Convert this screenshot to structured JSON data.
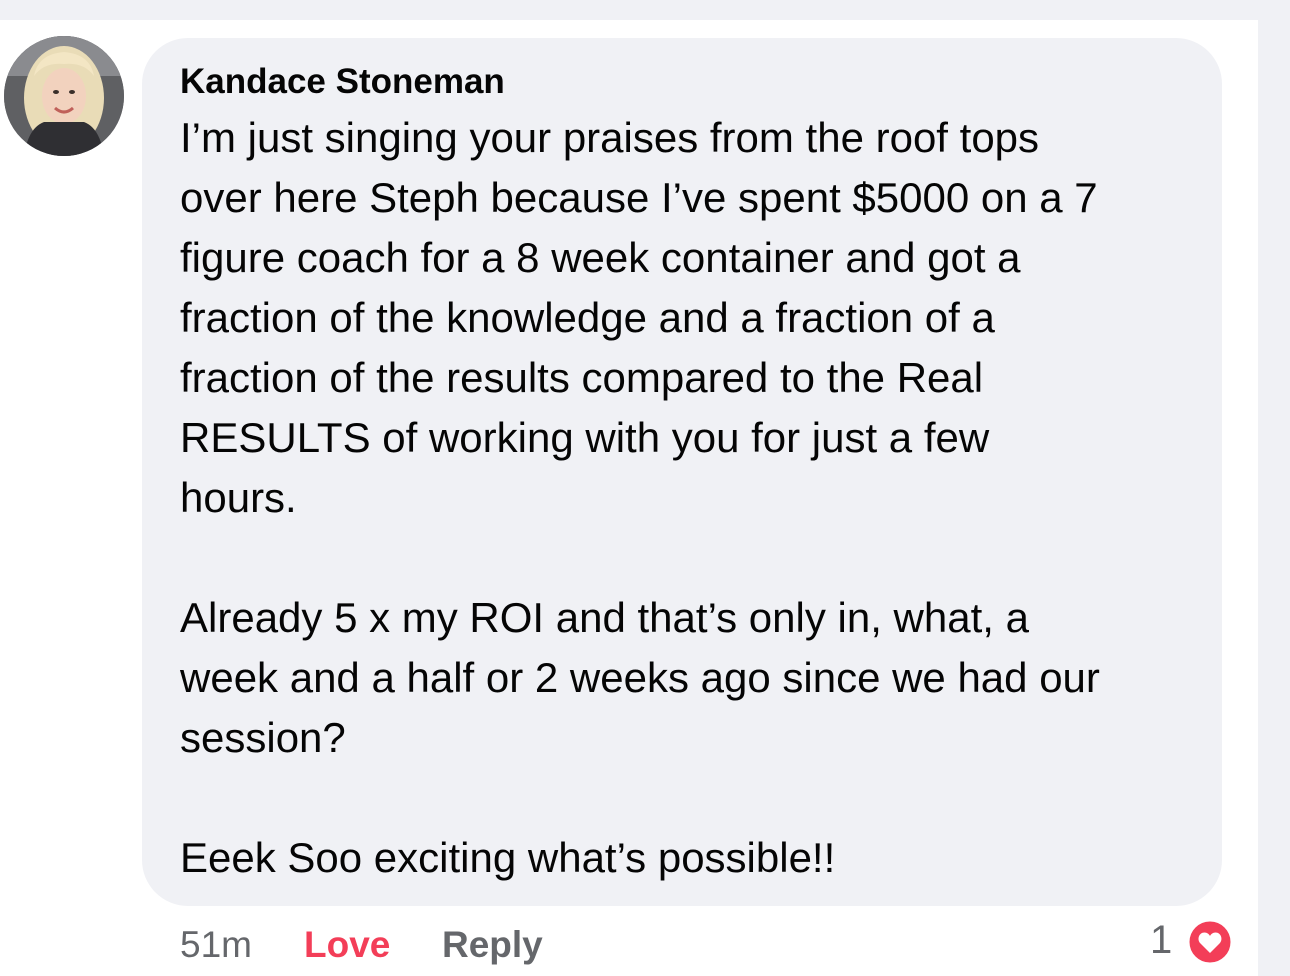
{
  "comment": {
    "author": "Kandace Stoneman",
    "paragraphs": [
      {
        "lines": [
          "I’m just singing your praises from the roof tops",
          "over here Steph because I’ve spent $5000 on a 7",
          "figure coach for a 8 week container and got a",
          "fraction of the knowledge and a fraction of a",
          "fraction of the results compared to the Real",
          "RESULTS of working with you for just a few",
          "hours."
        ]
      },
      {
        "lines": [
          "Already 5 x my ROI and that’s only in, what, a",
          "week and a half or 2 weeks ago since we had our",
          "session?"
        ]
      },
      {
        "lines": [
          "Eeek Soo exciting what’s possible!!"
        ]
      }
    ],
    "timestamp": "51m",
    "love_label": "Love",
    "reply_label": "Reply",
    "reaction_count": "1",
    "reaction_icon": "heart-icon"
  },
  "colors": {
    "bubble": "#f0f1f5",
    "love": "#f33e58",
    "meta": "#65676b",
    "text": "#050505"
  }
}
